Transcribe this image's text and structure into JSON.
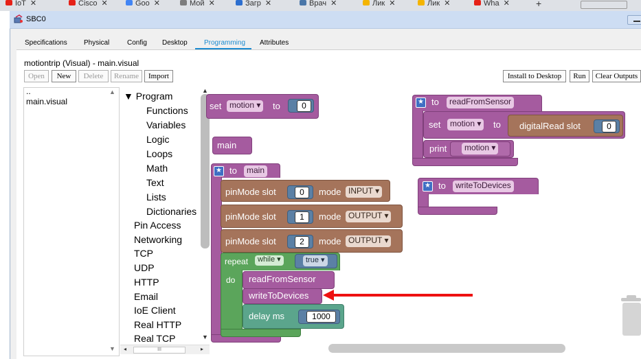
{
  "browser": {
    "tabs": [
      {
        "label": "IoT",
        "icon": "youtube-icon",
        "color": "#e62117"
      },
      {
        "label": "Cisco",
        "icon": "youtube-icon",
        "color": "#e62117"
      },
      {
        "label": "Goo",
        "icon": "google-icon",
        "color": "#4285f4"
      },
      {
        "label": "Мой",
        "icon": "doc-icon",
        "color": "#7d7d7d"
      },
      {
        "label": "Загр",
        "icon": "gear-icon",
        "color": "#2d6fcf"
      },
      {
        "label": "Врач",
        "icon": "vk-icon",
        "color": "#4a76a8"
      },
      {
        "label": "Лик",
        "icon": "shield-icon",
        "color": "#f4b400"
      },
      {
        "label": "Лик",
        "icon": "shield-icon",
        "color": "#f4b400"
      },
      {
        "label": "Wha",
        "icon": "youtube-icon",
        "color": "#e62117"
      }
    ],
    "new_tab": "+"
  },
  "window": {
    "title": "SBC0",
    "icon": "device-icon"
  },
  "tabs": [
    {
      "label": "Specifications"
    },
    {
      "label": "Physical"
    },
    {
      "label": "Config"
    },
    {
      "label": "Desktop"
    },
    {
      "label": "Programming",
      "active": true
    },
    {
      "label": "Attributes"
    }
  ],
  "project": {
    "path": "motiontrip (Visual) - main.visual"
  },
  "toolbar": {
    "open": "Open",
    "new": "New",
    "delete": "Delete",
    "rename": "Rename",
    "import": "Import",
    "install": "Install to Desktop",
    "run": "Run",
    "clear": "Clear Outputs"
  },
  "files": {
    "up": "..",
    "items": [
      "main.visual"
    ]
  },
  "toolbox": {
    "program": "▼ Program",
    "program_children": [
      "Functions",
      "Variables",
      "Logic",
      "Loops",
      "Math",
      "Text",
      "Lists",
      "Dictionaries"
    ],
    "categories": [
      "Pin Access",
      "Networking",
      "TCP",
      "UDP",
      "HTTP",
      "Email",
      "IoE Client",
      "Real HTTP",
      "Real TCP"
    ],
    "hscroll_grip": "III"
  },
  "blocks": {
    "set_motion": {
      "set": "set",
      "var": "motion",
      "to": "to",
      "value": "0"
    },
    "main_call": {
      "label": "main"
    },
    "main_def": {
      "to": "to",
      "name": "main"
    },
    "pinmodes": [
      {
        "label": "pinMode  slot",
        "slot": "0",
        "mode_label": "mode",
        "mode": "INPUT"
      },
      {
        "label": "pinMode  slot",
        "slot": "1",
        "mode_label": "mode",
        "mode": "OUTPUT"
      },
      {
        "label": "pinMode  slot",
        "slot": "2",
        "mode_label": "mode",
        "mode": "OUTPUT"
      }
    ],
    "repeat": {
      "repeat": "repeat",
      "while": "while",
      "cond": "true",
      "do": "do"
    },
    "calls": {
      "read": "readFromSensor",
      "write": "writeToDevices"
    },
    "delay": {
      "label": "delay  ms",
      "value": "1000"
    },
    "read_def": {
      "to": "to",
      "name": "readFromSensor",
      "set": "set",
      "var": "motion",
      "set_to": "to",
      "func": "digitalRead  slot",
      "slot": "0",
      "print": "print",
      "print_var": "motion"
    },
    "write_def": {
      "to": "to",
      "name": "writeToDevices"
    }
  },
  "colors": {
    "procedure": "#a55b9f",
    "io": "#a5745b",
    "math": "#5b80a5",
    "loop": "#5ba55b",
    "time": "#5ba58c",
    "accent": "#1a8ad0",
    "annotation_arrow": "#ee1111"
  }
}
